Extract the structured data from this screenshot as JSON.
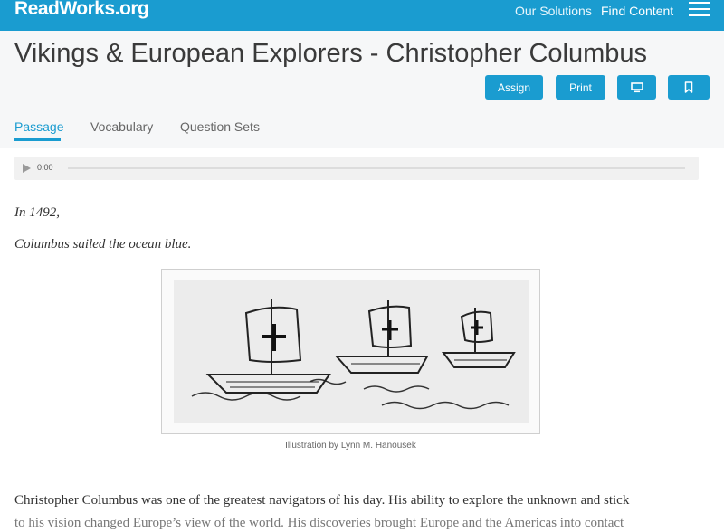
{
  "topbar": {
    "logo": "ReadWorks.org",
    "nav_our_solutions": "Our Solutions",
    "nav_find_content": "Find Content"
  },
  "header": {
    "title": "Vikings & European Explorers - Christopher Columbus",
    "assign_label": "Assign",
    "print_label": "Print"
  },
  "tabs": {
    "passage": "Passage",
    "vocabulary": "Vocabulary",
    "question_sets": "Question Sets"
  },
  "audio": {
    "time": "0:00"
  },
  "passage": {
    "poem_line_1": "In 1492,",
    "poem_line_2": "Columbus sailed the ocean blue.",
    "figure_caption": "Illustration by Lynn M. Hanousek",
    "paragraph_line_1": "Christopher Columbus was one of the greatest navigators of his day. His ability to explore the unknown and stick",
    "paragraph_line_2": "to his vision changed Europe’s view of the world. His discoveries brought Europe and the Americas into contact"
  },
  "colors": {
    "brand": "#1a9cd0"
  }
}
